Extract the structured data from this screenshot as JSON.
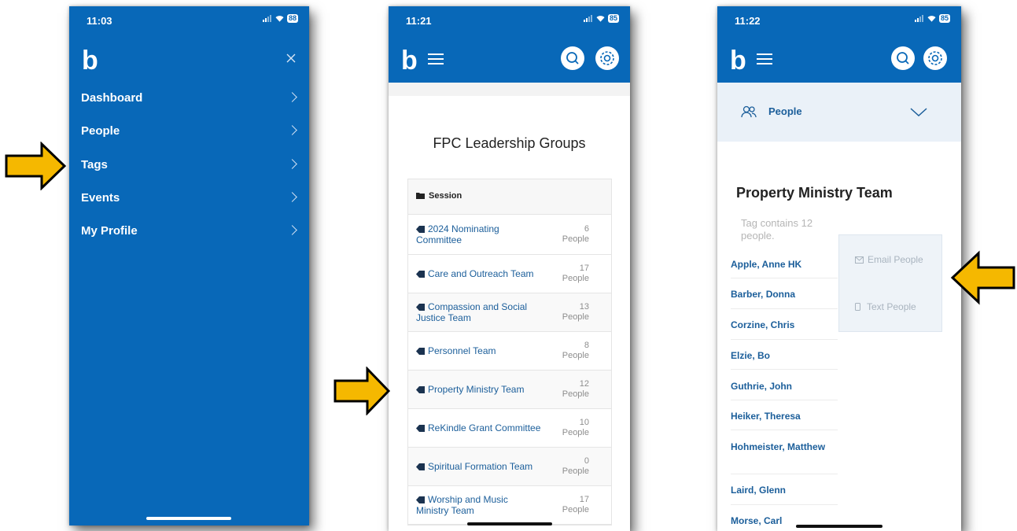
{
  "colors": {
    "brand_blue": "#0868b8",
    "link_blue": "#1b5e9a",
    "arrow_yellow": "#f5b800"
  },
  "screen1": {
    "time": "11:03",
    "battery": "88",
    "menu": [
      {
        "label": "Dashboard"
      },
      {
        "label": "People"
      },
      {
        "label": "Tags"
      },
      {
        "label": "Events"
      },
      {
        "label": "My Profile"
      }
    ]
  },
  "screen2": {
    "time": "11:21",
    "battery": "85",
    "title": "FPC Leadership Groups",
    "folder": "Session",
    "tags": [
      {
        "name": "2024 Nominating Committee",
        "count": "6",
        "unit": "People"
      },
      {
        "name": "Care and Outreach Team",
        "count": "17",
        "unit": "People"
      },
      {
        "name": "Compassion and Social Justice Team",
        "count": "13",
        "unit": "People"
      },
      {
        "name": "Personnel Team",
        "count": "8",
        "unit": "People"
      },
      {
        "name": "Property Ministry Team",
        "count": "12",
        "unit": "People"
      },
      {
        "name": "ReKindle Grant Committee",
        "count": "10",
        "unit": "People"
      },
      {
        "name": "Spiritual Formation Team",
        "count": "0",
        "unit": "People"
      },
      {
        "name": "Worship and Music Ministry Team",
        "count": "17",
        "unit": "People"
      }
    ]
  },
  "screen3": {
    "time": "11:22",
    "battery": "85",
    "section": "People",
    "title": "Property Ministry Team",
    "subtitle": "Tag contains 12 people.",
    "email_action": "Email People",
    "text_action": "Text People",
    "people": [
      "Apple, Anne HK",
      "Barber, Donna",
      "Corzine, Chris",
      "Elzie, Bo",
      "Guthrie, John",
      "Heiker, Theresa",
      "Hohmeister, Matthew",
      "Laird, Glenn",
      "Morse, Carl"
    ]
  }
}
